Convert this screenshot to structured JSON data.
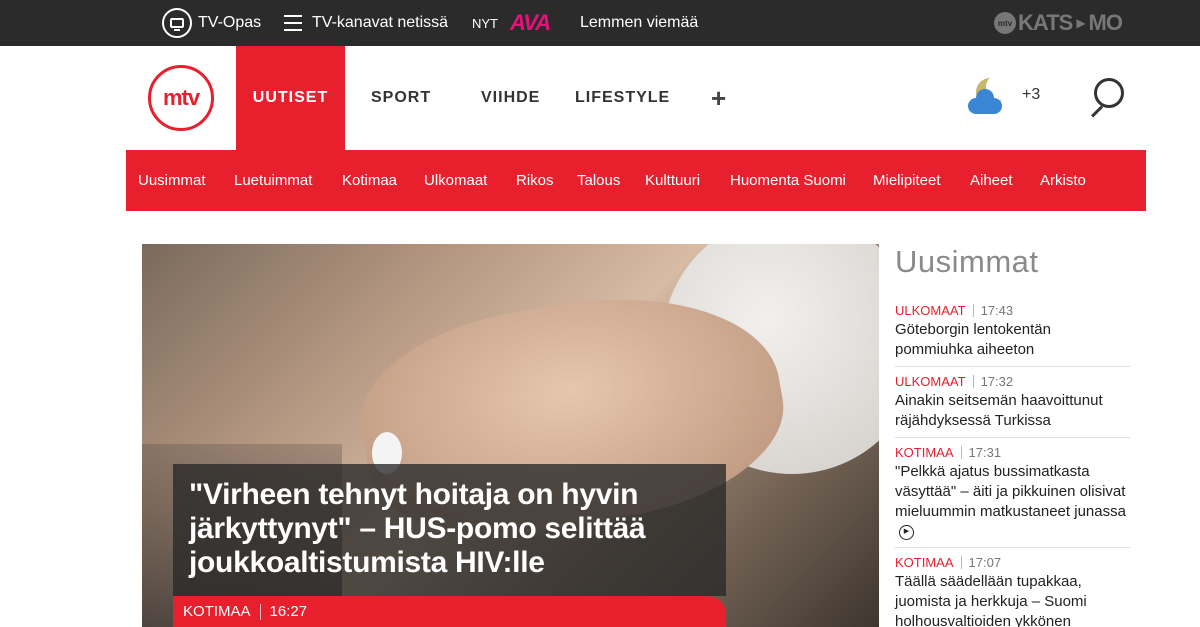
{
  "topbar": {
    "tv_guide_label": "TV-Opas",
    "channels_label": "TV-kanavat netissä",
    "now_label": "NYT",
    "channel_logo_text": "AVA",
    "now_program": "Lemmen viemää",
    "katsomo_badge": "mtv",
    "katsomo_left": "KATS",
    "katsomo_right": "MO"
  },
  "header": {
    "logo_text": "mtv",
    "nav": [
      "UUTISET",
      "SPORT",
      "VIIHDE",
      "LIFESTYLE"
    ],
    "plus_label": "+",
    "weather_temp": "+3"
  },
  "subnav": [
    "Uusimmat",
    "Luetuimmat",
    "Kotimaa",
    "Ulkomaat",
    "Rikos",
    "Talous",
    "Kulttuuri",
    "Huomenta Suomi",
    "Mielipiteet",
    "Aiheet",
    "Arkisto"
  ],
  "hero": {
    "headline": "\"Virheen tehnyt hoitaja on hyvin järkyttynyt\" – HUS-pomo selittää joukkoaltistumista HIV:lle",
    "category": "KOTIMAA",
    "time": "16:27"
  },
  "sidebar": {
    "title": "Uusimmat",
    "items": [
      {
        "category": "ULKOMAAT",
        "time": "17:43",
        "text": "Göteborgin lentokentän pommiuhka aiheeton"
      },
      {
        "category": "ULKOMAAT",
        "time": "17:32",
        "text": "Ainakin seitsemän haavoittunut räjähdyksessä Turkissa"
      },
      {
        "category": "KOTIMAA",
        "time": "17:31",
        "text": "\"Pelkkä ajatus bussimatkasta väsyttää\" – äiti ja pikkuinen olisivat mieluummin matkustaneet junassa"
      },
      {
        "category": "KOTIMAA",
        "time": "17:07",
        "text": "Täällä säädellään tupakkaa, juomista ja herkkuja – Suomi holhousvaltioiden ykkönen"
      }
    ]
  },
  "colors": {
    "brand_red": "#e8202e",
    "topbar_bg": "#2b2b2b",
    "ava_pink": "#e6117a"
  }
}
